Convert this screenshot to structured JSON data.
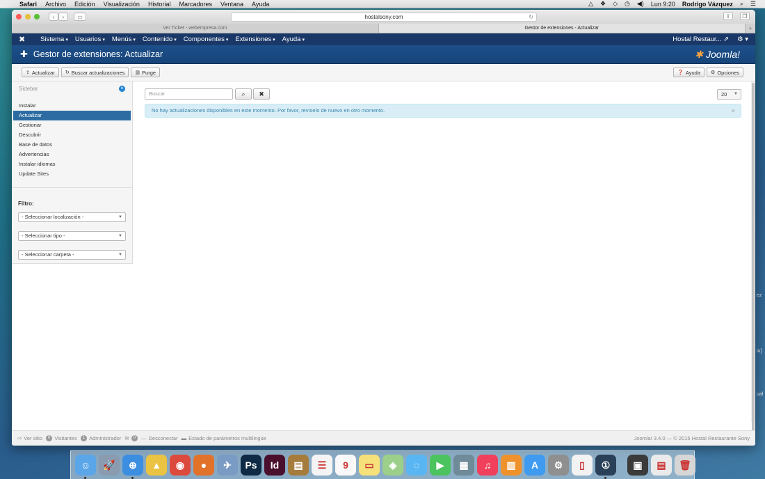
{
  "menubar": {
    "app": "Safari",
    "items": [
      "Archivo",
      "Edición",
      "Visualización",
      "Historial",
      "Marcadores",
      "Ventana",
      "Ayuda"
    ],
    "clock": "Lun 9:20",
    "user": "Rodrigo Vázquez"
  },
  "browser": {
    "url": "hostalsony.com",
    "tabs": [
      {
        "label": "Ver Ticket - webempresa.com",
        "active": false
      },
      {
        "label": "Gestor de extensiones - Actualizar",
        "active": true
      }
    ]
  },
  "admin_nav": {
    "items": [
      "Sistema",
      "Usuarios",
      "Menús",
      "Contenido",
      "Componentes",
      "Extensiones",
      "Ayuda"
    ],
    "site_link": "Hostal Restaur..."
  },
  "header": {
    "title": "Gestor de extensiones: Actualizar",
    "brand": "Joomla!"
  },
  "toolbar": {
    "update": "Actualizar",
    "find_updates": "Buscar actualizaciones",
    "purge": "Purge",
    "help": "Ayuda",
    "options": "Opciones"
  },
  "sidebar": {
    "label": "Sidebar",
    "items": [
      {
        "label": "Instalar",
        "active": false
      },
      {
        "label": "Actualizar",
        "active": true
      },
      {
        "label": "Gestionar",
        "active": false
      },
      {
        "label": "Descubrir",
        "active": false
      },
      {
        "label": "Base de datos",
        "active": false
      },
      {
        "label": "Advertencias",
        "active": false
      },
      {
        "label": "Instalar idiomas",
        "active": false
      },
      {
        "label": "Update Sites",
        "active": false
      }
    ],
    "filter_title": "Filtro:",
    "filters": [
      "- Seleccionar localización -",
      "- Seleccionar tipo -",
      "- Seleccionar carpeta -"
    ]
  },
  "main": {
    "search_placeholder": "Buscar",
    "limit": "20",
    "alert": "No hay actualizaciones disponibles en este momento. Por favor, revíselo de nuevo en otro momento."
  },
  "footer": {
    "view_site": "Ver sitio",
    "visitors_count": "0",
    "visitors": "Visitantes",
    "admins_count": "1",
    "admins": "Administrador",
    "messages_count": "0",
    "logout": "Desconectar",
    "multilang": "Estado de parámetros multilingüe",
    "copyright": "Joomla! 3.4.0 — © 2015 Hostal Restaurante Sony"
  },
  "desktop_peek": [
    "ez",
    "iu]",
    "ual"
  ],
  "dock": {
    "apps": [
      {
        "name": "finder-icon",
        "color": "#5aa6e8",
        "glyph": "☺",
        "running": true
      },
      {
        "name": "launchpad-icon",
        "color": "#8a9bb0",
        "glyph": "🚀",
        "running": false
      },
      {
        "name": "safari-icon",
        "color": "#3c8ee0",
        "glyph": "⊕",
        "running": true
      },
      {
        "name": "drive-icon",
        "color": "#e9c341",
        "glyph": "▲",
        "running": false
      },
      {
        "name": "chrome-icon",
        "color": "#dc4a3d",
        "glyph": "◉",
        "running": false
      },
      {
        "name": "firefox-icon",
        "color": "#e2722a",
        "glyph": "●",
        "running": false
      },
      {
        "name": "preview-icon",
        "color": "#7a9cc4",
        "glyph": "✈",
        "running": false
      },
      {
        "name": "photoshop-icon",
        "color": "#0f2a44",
        "glyph": "Ps",
        "running": false
      },
      {
        "name": "indesign-icon",
        "color": "#4b0f2e",
        "glyph": "Id",
        "running": false
      },
      {
        "name": "notebook-icon",
        "color": "#a67c3d",
        "glyph": "▤",
        "running": false
      },
      {
        "name": "reminders-icon",
        "color": "#f4f4f4",
        "glyph": "☰",
        "running": false
      },
      {
        "name": "calendar-icon",
        "color": "#f8f8f8",
        "glyph": "9",
        "running": false
      },
      {
        "name": "notes-icon",
        "color": "#f6e07a",
        "glyph": "▭",
        "running": false
      },
      {
        "name": "maps-icon",
        "color": "#9cd08a",
        "glyph": "◈",
        "running": false
      },
      {
        "name": "messages-icon",
        "color": "#5ab6f2",
        "glyph": "◌",
        "running": false
      },
      {
        "name": "facetime-icon",
        "color": "#4bc35f",
        "glyph": "▶",
        "running": false
      },
      {
        "name": "photo-icon",
        "color": "#6f8a98",
        "glyph": "▦",
        "running": false
      },
      {
        "name": "itunes-icon",
        "color": "#f0405c",
        "glyph": "♫",
        "running": false
      },
      {
        "name": "ibooks-icon",
        "color": "#f0922c",
        "glyph": "▥",
        "running": false
      },
      {
        "name": "appstore-icon",
        "color": "#3e9bef",
        "glyph": "A",
        "running": false
      },
      {
        "name": "system-preferences-icon",
        "color": "#8f8f8f",
        "glyph": "⚙",
        "running": false
      },
      {
        "name": "document-icon",
        "color": "#f2f2f2",
        "glyph": "▯",
        "running": false
      },
      {
        "name": "1password-icon",
        "color": "#2a3f58",
        "glyph": "①",
        "running": true
      }
    ],
    "right_apps": [
      {
        "name": "downloads-stack-icon",
        "color": "#3b3b3b",
        "glyph": "▣"
      },
      {
        "name": "documents-stack-icon",
        "color": "#eaeaea",
        "glyph": "▤"
      },
      {
        "name": "trash-icon",
        "color": "#d6d6d6",
        "glyph": "🗑"
      }
    ]
  }
}
